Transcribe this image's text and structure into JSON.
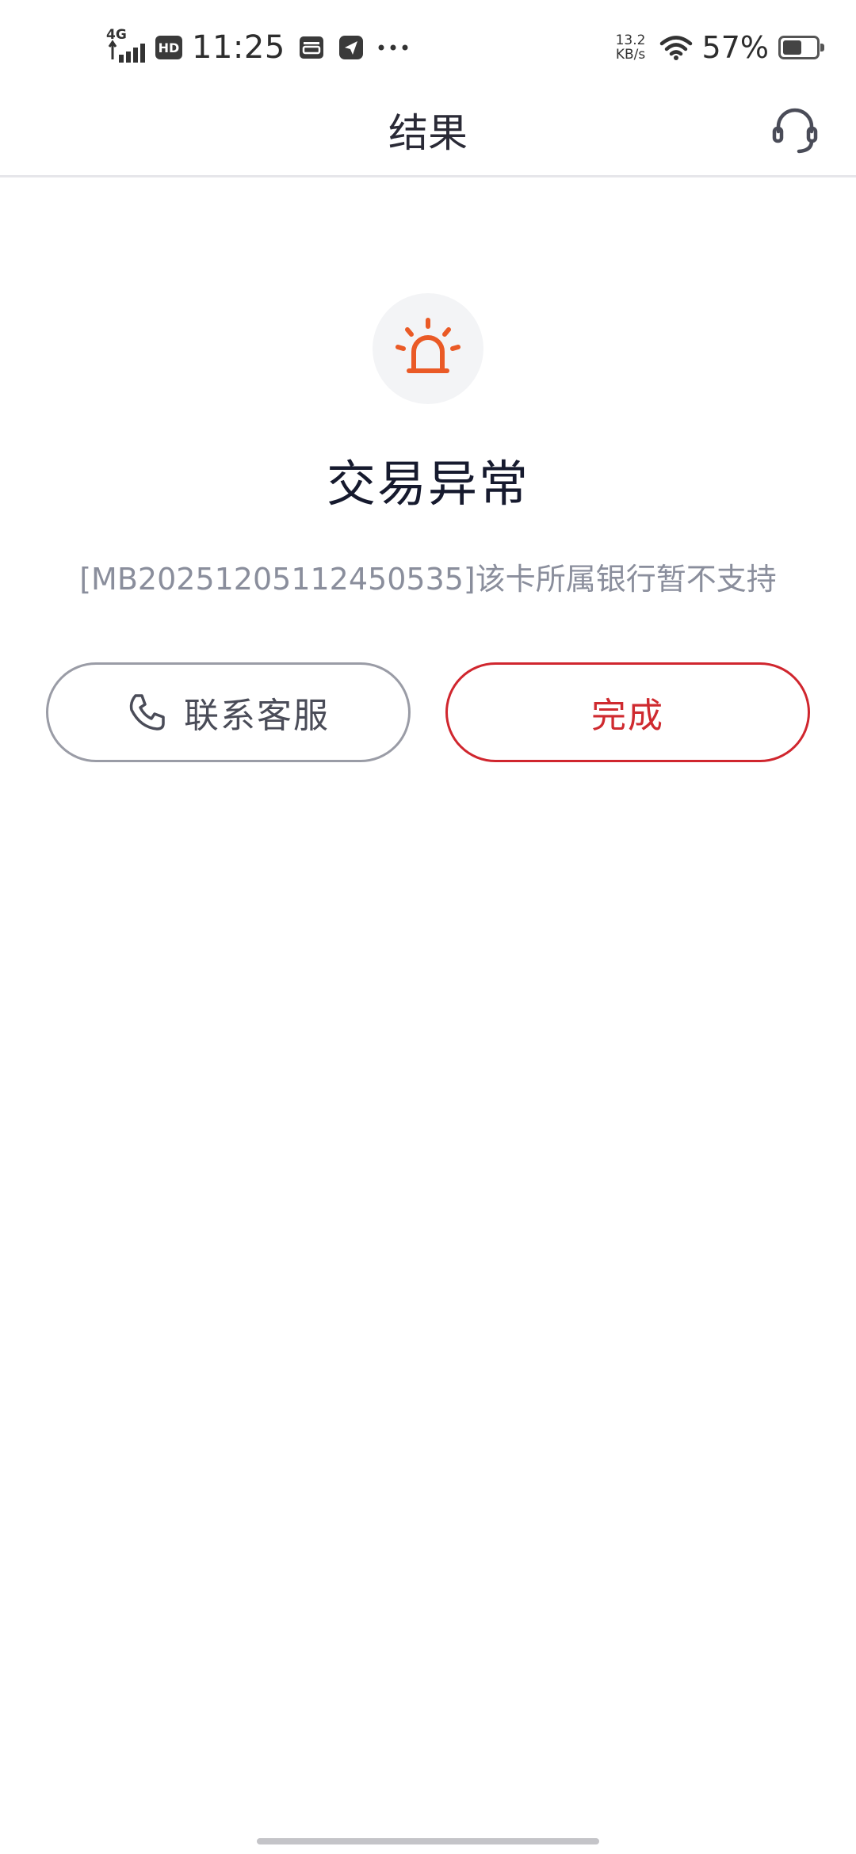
{
  "status_bar": {
    "network": "4G",
    "hd": "HD",
    "time": "11:25",
    "speed_value": "13.2",
    "speed_unit": "KB/s",
    "battery_text": "57%",
    "battery_level_percent": 57,
    "icons": [
      "signal-icon",
      "hd-icon",
      "wallet-icon",
      "send-icon",
      "more-icon",
      "wifi-icon",
      "battery-icon"
    ]
  },
  "nav": {
    "title": "结果",
    "right_icon": "headset-icon"
  },
  "result": {
    "icon": "alarm-icon",
    "title": "交易异常",
    "message": "[MB20251205112450535]该卡所属银行暂不支持"
  },
  "actions": {
    "contact_label": "联系客服",
    "contact_icon": "phone-icon",
    "done_label": "完成"
  },
  "colors": {
    "accent_red": "#cf2a2f",
    "alarm_orange": "#ea5a26",
    "muted_text": "#8a8e9c",
    "title_text": "#161a2e"
  }
}
